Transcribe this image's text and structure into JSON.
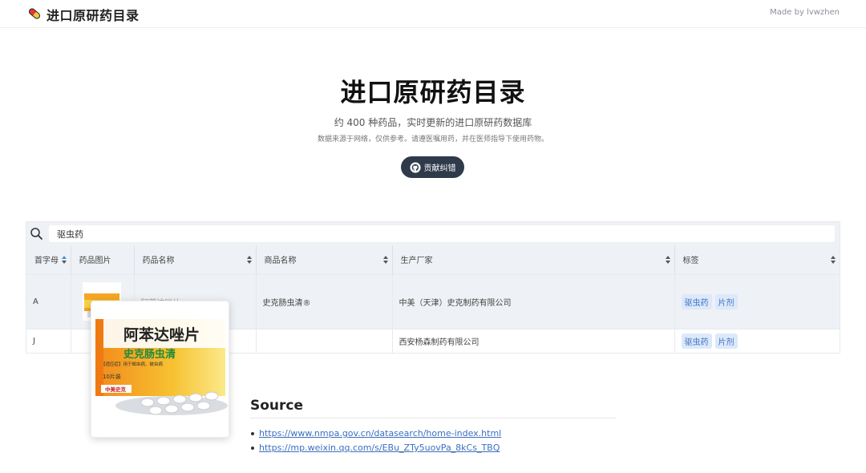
{
  "header": {
    "brand": "进口原研药目录",
    "made_by": "Made by  lvwzhen"
  },
  "hero": {
    "title": "进口原研药目录",
    "subtitle": "约 400 种药品，实时更新的进口原研药数据库",
    "note": "数据来源于网络，仅供参考。请遵医嘱用药，并在医师指导下使用药物。",
    "contribute_label": "贡献纠错"
  },
  "search": {
    "value": "驱虫药"
  },
  "table": {
    "columns": [
      "首字母",
      "药品图片",
      "药品名称",
      "商品名称",
      "生产厂家",
      "标签"
    ],
    "rows": [
      {
        "letter": "A",
        "drug_name": "阿苯达唑片",
        "brand_name": "史克肠虫清®",
        "manufacturer": "中美（天津）史克制药有限公司",
        "tags": [
          "驱虫药",
          "片剂"
        ]
      },
      {
        "letter": "J",
        "drug_name": "",
        "brand_name": "",
        "manufacturer": "西安杨森制药有限公司",
        "tags": [
          "驱虫药",
          "片剂"
        ]
      }
    ]
  },
  "popup_image": {
    "product_name": "阿苯达唑片",
    "brand": "史克肠虫清",
    "indication": "【适应症】用于蛔虫病、蛲虫病",
    "count": "10片装",
    "company": "中美史克"
  },
  "source": {
    "title": "Source",
    "links": [
      "https://www.nmpa.gov.cn/datasearch/home-index.html",
      "https://mp.weixin.qq.com/s/EBu_ZTy5uovPa_8kCs_TBQ"
    ]
  },
  "colors": {
    "accent": "#4a8fe0",
    "button_bg": "#2f3a4a",
    "tag_bg": "#dde8fa",
    "tag_text": "#3a73c4",
    "link": "#3b6fbf"
  }
}
